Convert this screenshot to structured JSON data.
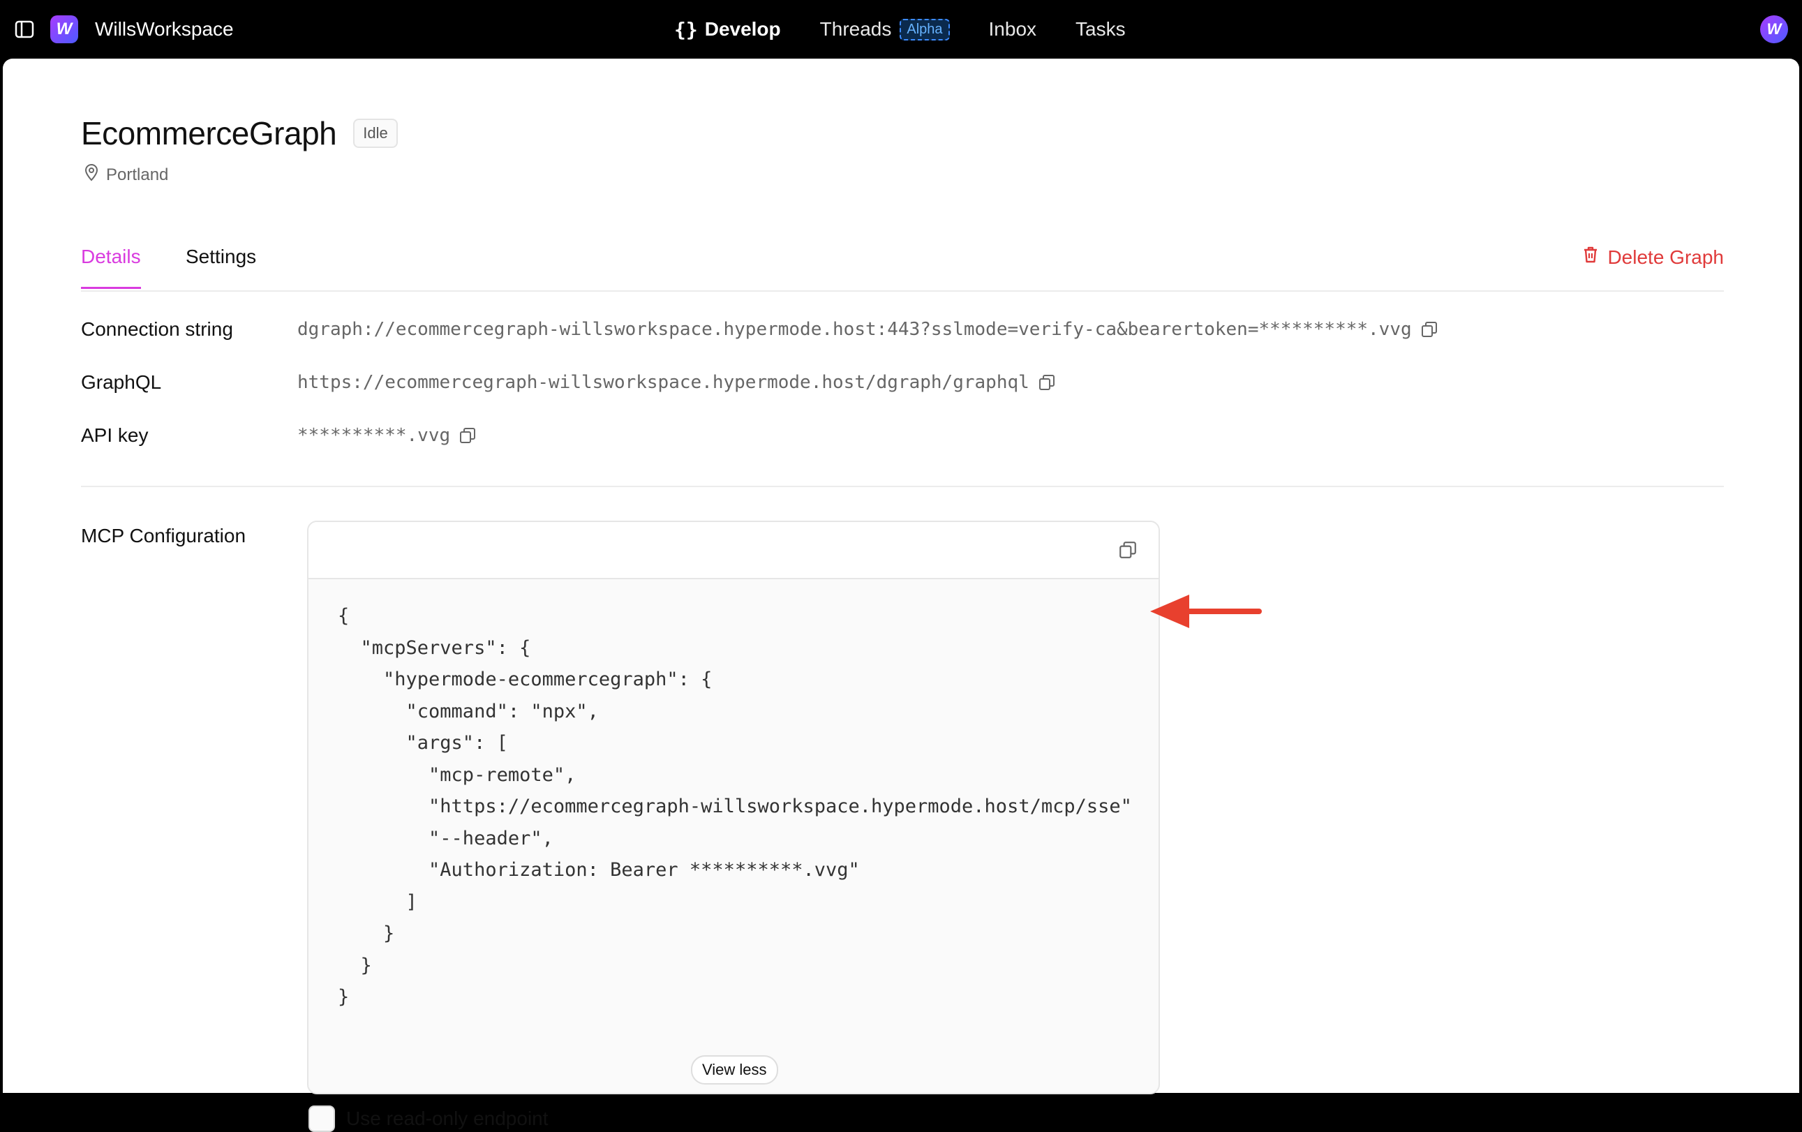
{
  "topbar": {
    "workspace_name": "WillsWorkspace",
    "logo_letter": "W",
    "avatar_letter": "W",
    "nav": {
      "develop": "Develop",
      "threads": "Threads",
      "threads_badge": "Alpha",
      "inbox": "Inbox",
      "tasks": "Tasks"
    }
  },
  "graph": {
    "title": "EcommerceGraph",
    "status": "Idle",
    "location": "Portland"
  },
  "tabs": {
    "details": "Details",
    "settings": "Settings",
    "delete": "Delete Graph"
  },
  "details": {
    "connection_label": "Connection string",
    "connection_value": "dgraph://ecommercegraph-willsworkspace.hypermode.host:443?sslmode=verify-ca&bearertoken=**********.vvg",
    "graphql_label": "GraphQL",
    "graphql_value": "https://ecommercegraph-willsworkspace.hypermode.host/dgraph/graphql",
    "apikey_label": "API key",
    "apikey_value": "**********.vvg"
  },
  "mcp": {
    "label": "MCP Configuration",
    "code": "{\n  \"mcpServers\": {\n    \"hypermode-ecommercegraph\": {\n      \"command\": \"npx\",\n      \"args\": [\n        \"mcp-remote\",\n        \"https://ecommercegraph-willsworkspace.hypermode.host/mcp/sse\"\n        \"--header\",\n        \"Authorization: Bearer **********.vvg\"\n      ]\n    }\n  }\n}",
    "view_less": "View less",
    "readonly_label": "Use read-only endpoint"
  },
  "colors": {
    "accent": "#d93bdf",
    "danger": "#e03a3a",
    "annotation_arrow": "#e8402e"
  },
  "icons": [
    "sidebar-toggle-icon",
    "map-pin-icon",
    "trash-icon",
    "copy-icon",
    "arrow-left-icon"
  ]
}
